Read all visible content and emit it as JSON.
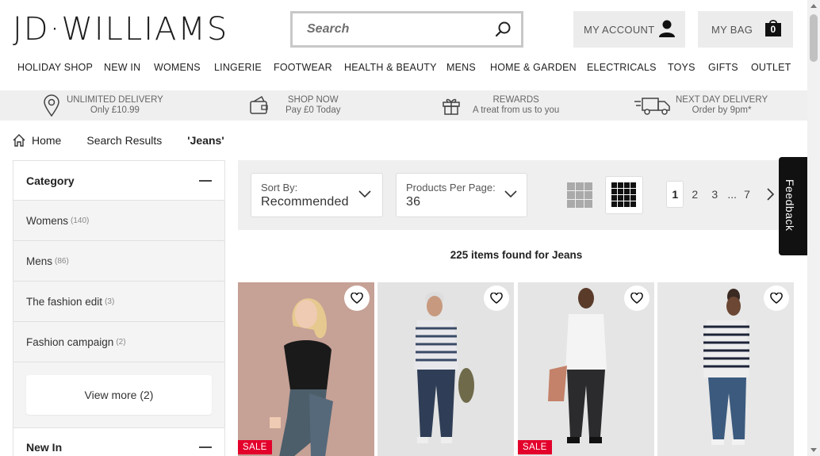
{
  "header": {
    "logo": "JD·WILLIAMS",
    "search_placeholder": "Search",
    "account_label": "MY ACCOUNT",
    "bag_label": "MY BAG",
    "bag_count": "0"
  },
  "nav": [
    "HOLIDAY SHOP",
    "NEW IN",
    "WOMENS",
    "LINGERIE",
    "FOOTWEAR",
    "HEALTH & BEAUTY",
    "MENS",
    "HOME & GARDEN",
    "ELECTRICALS",
    "TOYS",
    "GIFTS",
    "OUTLET"
  ],
  "promo": [
    {
      "line1": "UNLIMITED DELIVERY",
      "line2": "Only £10.99",
      "icon": "location-pin-icon"
    },
    {
      "line1": "SHOP NOW",
      "line2": "Pay £0 Today",
      "icon": "wallet-icon"
    },
    {
      "line1": "REWARDS",
      "line2": "A treat from us to you",
      "icon": "gift-icon"
    },
    {
      "line1": "NEXT DAY DELIVERY",
      "line2": "Order by 9pm*",
      "icon": "truck-icon"
    }
  ],
  "breadcrumb": {
    "home": "Home",
    "search": "Search Results",
    "term": "'Jeans'"
  },
  "sidebar": {
    "category_title": "Category",
    "items": [
      {
        "label": "Womens",
        "count": "(140)"
      },
      {
        "label": "Mens",
        "count": "(86)"
      },
      {
        "label": "The fashion edit",
        "count": "(3)"
      },
      {
        "label": "Fashion campaign",
        "count": "(2)"
      }
    ],
    "view_more": "View more (2)",
    "new_in_title": "New In"
  },
  "toolbar": {
    "sort_label": "Sort By:",
    "sort_value": "Recommended",
    "per_page_label": "Products Per Page:",
    "per_page_value": "36",
    "pages": [
      "1",
      "2",
      "3",
      "7"
    ],
    "ellipsis": "..."
  },
  "results_text": "225 items found for Jeans",
  "products": [
    {
      "sale": "SALE",
      "bg": "#c9a296"
    },
    {
      "sale": "",
      "bg": "#e2e2e2"
    },
    {
      "sale": "SALE",
      "bg": "#e4e4e4"
    },
    {
      "sale": "",
      "bg": "#e6e6e6"
    }
  ],
  "feedback": "Feedback",
  "colors": {
    "accent": "#e3002b",
    "promo_bg": "#efefef"
  }
}
